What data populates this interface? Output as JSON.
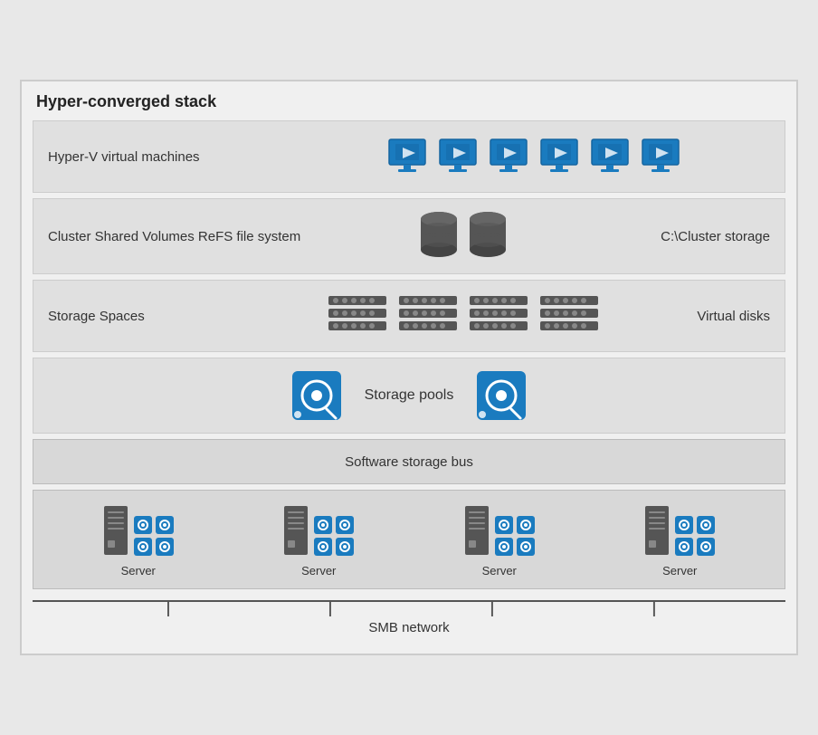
{
  "diagram": {
    "title": "Hyper-converged stack",
    "rows": {
      "vm": {
        "label": "Hyper-V virtual machines",
        "icon_count": 6
      },
      "csv": {
        "label": "Cluster Shared Volumes ReFS file system",
        "right_label": "C:\\Cluster storage",
        "db_count": 2
      },
      "storage_spaces": {
        "label": "Storage Spaces",
        "right_label": "Virtual disks",
        "array_count": 4
      },
      "storage_pools": {
        "label": "Storage pools",
        "hdd_count": 2
      },
      "software_bus": {
        "label": "Software storage bus"
      },
      "servers": {
        "label": "Server",
        "count": 4
      },
      "smb": {
        "label": "SMB network"
      }
    }
  }
}
